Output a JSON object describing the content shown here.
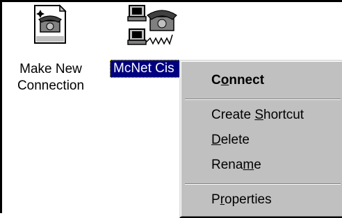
{
  "desktop": {
    "icons": [
      {
        "name": "make-new-connection",
        "label_line1": "Make New",
        "label_line2": "Connection",
        "icon": "make-new-connection-icon"
      },
      {
        "name": "mcnet-cisco",
        "label": "McNet Cis",
        "icon": "dialup-network-icon",
        "selected": true
      }
    ]
  },
  "context_menu": {
    "items": [
      {
        "pre": "C",
        "acc": "o",
        "post": "nnect",
        "bold": true
      },
      {
        "pre": "Create ",
        "acc": "S",
        "post": "hortcut"
      },
      {
        "pre": "",
        "acc": "D",
        "post": "elete"
      },
      {
        "pre": "Rena",
        "acc": "m",
        "post": "e"
      },
      {
        "pre": "P",
        "acc": "r",
        "post": "operties"
      }
    ]
  },
  "colors": {
    "selection": "#000080",
    "menu_bg": "#c0c0c0"
  }
}
